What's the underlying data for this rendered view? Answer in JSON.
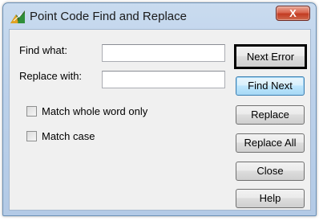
{
  "window": {
    "title": "Point Code Find and Replace",
    "close_label": "X",
    "app_icon": "point-code-app-icon"
  },
  "form": {
    "find_label": "Find what:",
    "find_value": "",
    "replace_label": "Replace with:",
    "replace_value": "",
    "match_whole_word_label": "Match whole word only",
    "match_whole_word_checked": false,
    "match_case_label": "Match case",
    "match_case_checked": false
  },
  "buttons": {
    "next_error": "Next Error",
    "find_next": "Find Next",
    "replace": "Replace",
    "replace_all": "Replace All",
    "close": "Close",
    "help": "Help"
  },
  "colors": {
    "highlight_outline": "#000000",
    "default_button": "#bee6fd",
    "close_button": "#c23b22"
  }
}
